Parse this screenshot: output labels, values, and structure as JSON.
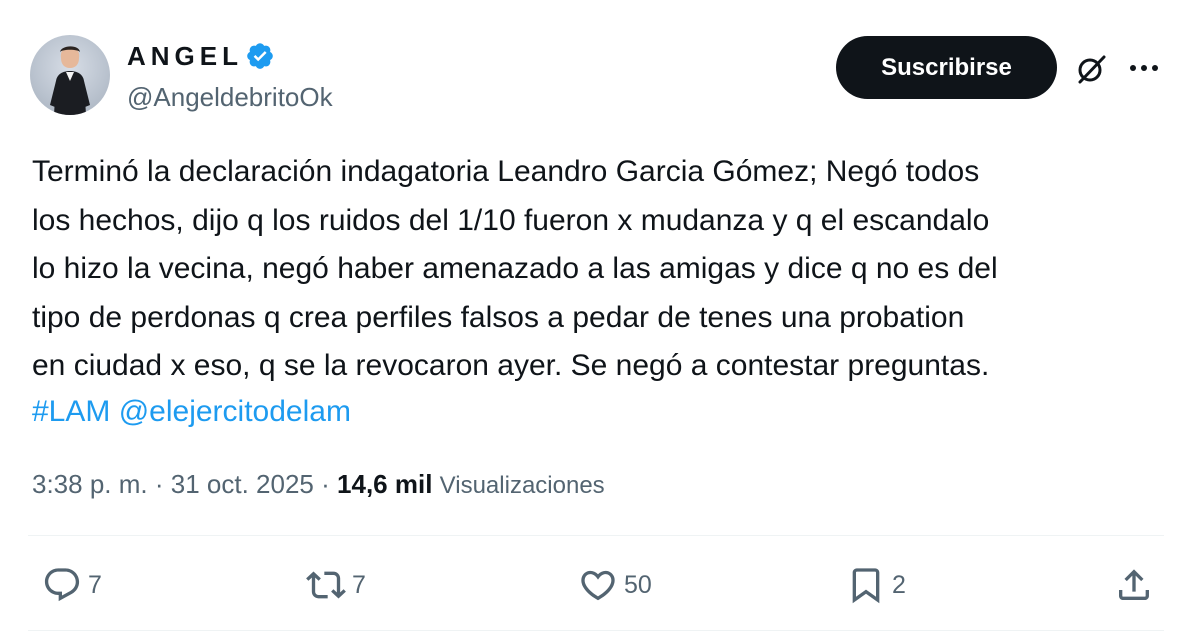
{
  "author": {
    "display_name": "ANGEL",
    "handle": "@AngeldebritoOk"
  },
  "subscribe_label": "Suscribirse",
  "tweet": {
    "text": "Terminó la declaración indagatoria Leandro Garcia Gómez; Negó todos\nlos hechos, dijo q los ruidos del 1/10 fueron x mudanza y q el escandalo\nlo hizo la vecina, negó haber amenazado a las amigas y dice q no es del\ntipo de perdonas q crea perfiles falsos a pedar de tenes una probation\nen ciudad x eso, q se la revocaron ayer. Se negó a contestar preguntas.",
    "hashtag": "#LAM",
    "mention": "@elejercitodelam"
  },
  "meta": {
    "time": "3:38 p. m.",
    "separator": "·",
    "date": "31 oct. 2025",
    "views_count": "14,6 mil",
    "views_label": "Visualizaciones"
  },
  "actions": {
    "replies": "7",
    "reposts": "7",
    "likes": "50",
    "bookmarks": "2"
  },
  "colors": {
    "text": "#0f1419",
    "secondary": "#536471",
    "link": "#1d9bf0",
    "verified": "#1d9bf0",
    "button_bg": "#0f1419"
  },
  "icons": [
    "verified-badge-icon",
    "grok-icon",
    "more-icon",
    "reply-icon",
    "repost-icon",
    "like-icon",
    "bookmark-icon",
    "share-icon"
  ]
}
